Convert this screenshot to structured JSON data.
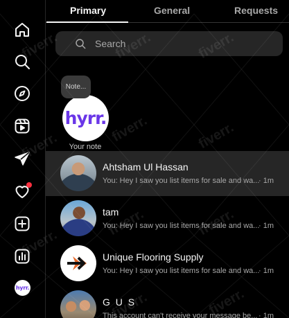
{
  "tabs": [
    {
      "label": "Primary",
      "active": true
    },
    {
      "label": "General",
      "active": false
    },
    {
      "label": "Requests",
      "active": false
    }
  ],
  "search": {
    "placeholder": "Search"
  },
  "note": {
    "bubble_text": "Note...",
    "avatar_text": "hyrr.",
    "label": "Your note"
  },
  "rail": {
    "icons": [
      "home-icon",
      "search-icon",
      "explore-icon",
      "reels-icon",
      "messages-icon",
      "notifications-icon",
      "create-icon",
      "dashboard-icon"
    ],
    "avatar_text": "hyrr."
  },
  "conversations": [
    {
      "name": "Ahtsham Ul Hassan",
      "preview": "You: Hey I saw you list items for sale and wa...",
      "time": "· 1m",
      "selected": true
    },
    {
      "name": "tam",
      "preview": "You: Hey I saw you list items for sale and wa...",
      "time": "· 1m",
      "selected": false
    },
    {
      "name": "Unique Flooring Supply",
      "preview": "You: Hey I saw you list items for sale and wa...",
      "time": "· 1m",
      "selected": false
    },
    {
      "name": "G U S",
      "preview": "This account can't receive your message be...",
      "time": "· 1m",
      "selected": false
    }
  ],
  "watermark": "fiverr.",
  "colors": {
    "background": "#000000",
    "selected_row": "#262626",
    "brand_purple": "#6a36e8",
    "notification_red": "#ff3040"
  }
}
